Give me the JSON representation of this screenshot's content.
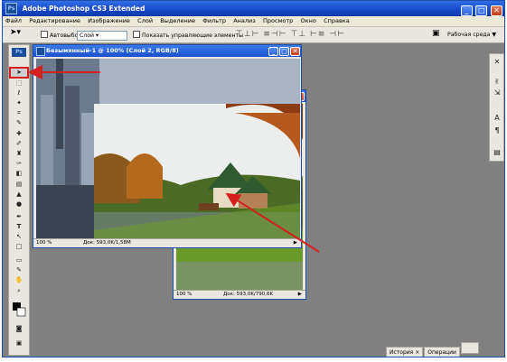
{
  "app": {
    "title": "Adobe Photoshop CS3 Extended",
    "logo": "Ps",
    "window_buttons": {
      "minimize": "_",
      "maximize": "□",
      "close": "✕"
    }
  },
  "menu": [
    "Файл",
    "Редактирование",
    "Изображение",
    "Слой",
    "Выделение",
    "Фильтр",
    "Анализ",
    "Просмотр",
    "Окно",
    "Справка"
  ],
  "options_bar": {
    "tool_icon": "move-tool-icon",
    "autoselect_label": "Автовыбор:",
    "autoselect_value": "Слой",
    "transform_label": "Показать управляющие элементы",
    "workspace_label": "Рабочая среда ▼"
  },
  "toolbox": {
    "header": "Ps",
    "tools": [
      "move-tool-icon",
      "marquee-tool-icon",
      "lasso-tool-icon",
      "magic-wand-icon",
      "crop-tool-icon",
      "eyedropper-icon",
      "healing-brush-icon",
      "brush-tool-icon",
      "clone-stamp-icon",
      "history-brush-icon",
      "eraser-icon",
      "gradient-tool-icon",
      "blur-tool-icon",
      "dodge-tool-icon",
      "pen-tool-icon",
      "type-tool-icon",
      "path-selection-icon",
      "shape-tool-icon",
      "notes-tool-icon",
      "eyedropper2-icon",
      "hand-tool-icon",
      "zoom-tool-icon",
      "color-swatch-icon",
      "quickmask-icon",
      "screen-mode-icon"
    ],
    "selected_tool": "move-tool-icon"
  },
  "doc1": {
    "title": "Безымянный-1 @ 100% (Слой 2, RGB/8)",
    "zoom": "100 %",
    "info": "Док: 593,0K/1,58M"
  },
  "doc2": {
    "zoom": "100 %",
    "info": "Док: 593,0K/790,6K"
  },
  "panels": {
    "history_tab": "История",
    "history_close": "×",
    "actions_tab": "Операции"
  },
  "colors": {
    "title_blue": "#1747c8",
    "highlight_red": "#d62020",
    "workspace_gray": "#808080"
  }
}
